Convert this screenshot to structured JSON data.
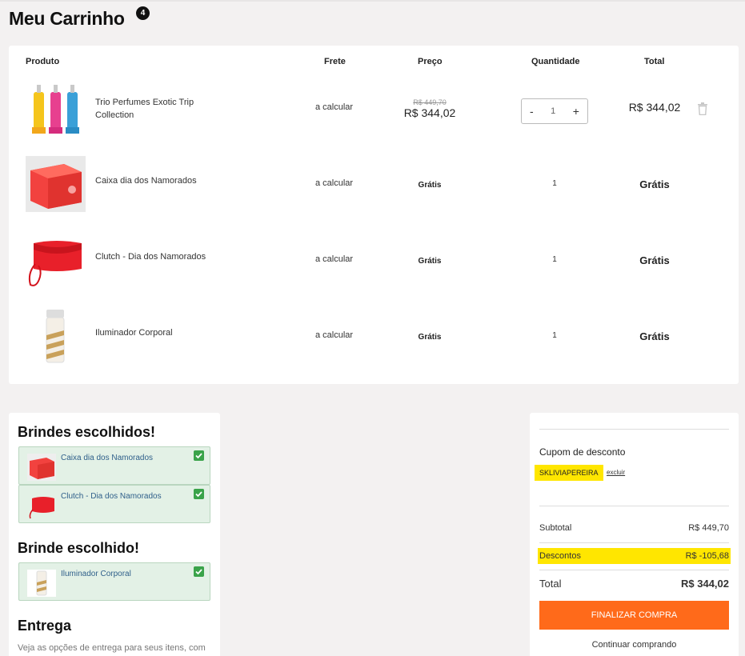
{
  "page": {
    "title": "Meu Carrinho",
    "cart_count": "4"
  },
  "table": {
    "headers": {
      "product": "Produto",
      "shipping": "Frete",
      "price": "Preço",
      "quantity": "Quantidade",
      "total": "Total"
    },
    "rows": [
      {
        "name": "Trio Perfumes Exotic Trip Collection",
        "shipping": "a calcular",
        "old_price": "R$ 449,70",
        "price": "R$ 344,02",
        "quantity": "1",
        "total": "R$ 344,02",
        "qty_minus": "-",
        "qty_plus": "+"
      },
      {
        "name": "Caixa dia dos Namorados",
        "shipping": "a calcular",
        "price": "Grátis",
        "quantity": "1",
        "total": "Grátis"
      },
      {
        "name": "Clutch - Dia dos Namorados",
        "shipping": "a calcular",
        "price": "Grátis",
        "quantity": "1",
        "total": "Grátis"
      },
      {
        "name": "Iluminador Corporal",
        "shipping": "a calcular",
        "price": "Grátis",
        "quantity": "1",
        "total": "Grátis"
      }
    ]
  },
  "gifts": {
    "title_plural": "Brindes escolhidos!",
    "items_plural": [
      {
        "label": "Caixa dia dos Namorados"
      },
      {
        "label": "Clutch - Dia dos Namorados"
      }
    ],
    "title_single": "Brinde escolhido!",
    "items_single": [
      {
        "label": "Iluminador Corporal"
      }
    ]
  },
  "delivery": {
    "title": "Entrega",
    "text": "Veja as opções de entrega para seus itens, com todos os prazos e valores."
  },
  "summary": {
    "coupon_title": "Cupom de desconto",
    "coupon_code": "SKLIVIAPEREIRA",
    "coupon_remove": "excluir",
    "subtotal_label": "Subtotal",
    "subtotal_value": "R$ 449,70",
    "discount_label": "Descontos",
    "discount_value": "R$ -105,68",
    "total_label": "Total",
    "total_value": "R$ 344,02",
    "finish_button": "FINALIZAR COMPRA",
    "continue_link": "Continuar comprando"
  },
  "colors": {
    "accent": "#ff6a1a",
    "highlight": "#ffe600",
    "gift_bg": "#e3f1e6",
    "check": "#3aa34a"
  },
  "icons": {
    "trash": "trash-icon",
    "check": "check-icon"
  }
}
